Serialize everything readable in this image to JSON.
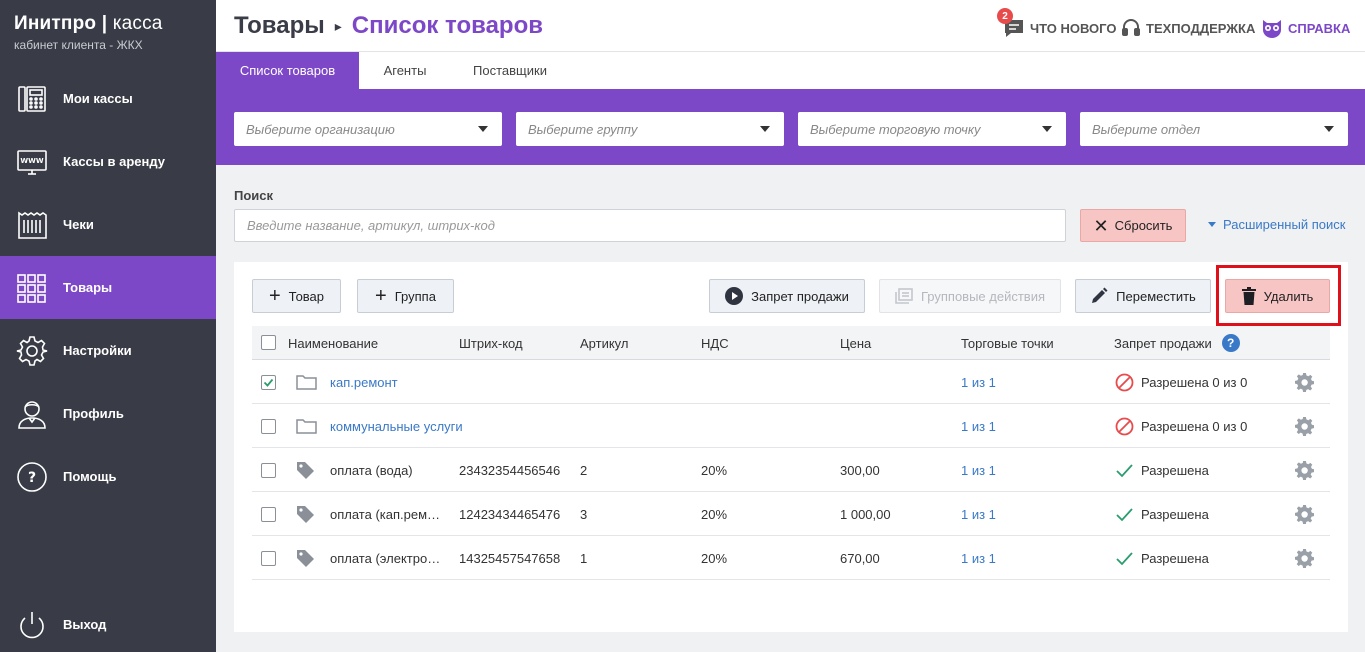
{
  "sidebar": {
    "brand_name": "Инитпро",
    "brand_sep": " | ",
    "brand_product": "касса",
    "brand_sub": "кабинет клиента - ЖКХ",
    "items": [
      {
        "label": "Мои кассы",
        "icon": "cash-register-icon",
        "active": false
      },
      {
        "label": "Кассы в аренду",
        "icon": "www-monitor-icon",
        "active": false
      },
      {
        "label": "Чеки",
        "icon": "receipt-icon",
        "active": false
      },
      {
        "label": "Товары",
        "icon": "grid-icon",
        "active": true
      },
      {
        "label": "Настройки",
        "icon": "gear-icon",
        "active": false
      },
      {
        "label": "Профиль",
        "icon": "user-icon",
        "active": false
      },
      {
        "label": "Помощь",
        "icon": "question-icon",
        "active": false
      }
    ],
    "logout": "Выход"
  },
  "header": {
    "crumb_parent": "Товары",
    "crumb_sep": "▸",
    "crumb_current": "Список товаров",
    "whats_new": "ЧТО НОВОГО",
    "whats_new_badge": "2",
    "support": "ТЕХПОДДЕРЖКА",
    "help": "СПРАВКА"
  },
  "tabs": [
    "Список товаров",
    "Агенты",
    "Поставщики"
  ],
  "filters": {
    "organization": "Выберите организацию",
    "group": "Выберите группу",
    "point": "Выберите торговую точку",
    "department": "Выберите отдел"
  },
  "search": {
    "label": "Поиск",
    "placeholder": "Введите название, артикул, штрих-код",
    "reset": "Сбросить",
    "advanced": "Расширенный поиск"
  },
  "toolbar": {
    "add_product": "Товар",
    "add_group": "Группа",
    "ban_sale": "Запрет продажи",
    "group_actions": "Групповые действия",
    "move": "Переместить",
    "delete": "Удалить"
  },
  "table": {
    "headers": {
      "name": "Наименование",
      "barcode": "Штрих-код",
      "article": "Артикул",
      "vat": "НДС",
      "price": "Цена",
      "points": "Торговые точки",
      "ban": "Запрет продажи",
      "help": "?"
    },
    "rows": [
      {
        "type": "folder",
        "checked": true,
        "name": "кап.ремонт",
        "barcode": "",
        "article": "",
        "vat": "",
        "price": "",
        "points": "1 из 1",
        "status": "Разрешена 0 из 0",
        "status_icon": "ban-icon"
      },
      {
        "type": "folder",
        "checked": false,
        "name": "коммунальные услуги",
        "barcode": "",
        "article": "",
        "vat": "",
        "price": "",
        "points": "1 из 1",
        "status": "Разрешена 0 из 0",
        "status_icon": "ban-icon"
      },
      {
        "type": "item",
        "checked": false,
        "name": "оплата (вода)",
        "barcode": "23432354456546",
        "article": "2",
        "vat": "20%",
        "price": "300,00",
        "points": "1 из 1",
        "status": "Разрешена",
        "status_icon": "check-icon"
      },
      {
        "type": "item",
        "checked": false,
        "name": "оплата (кап.рем…",
        "barcode": "12423434465476",
        "article": "3",
        "vat": "20%",
        "price": "1 000,00",
        "points": "1 из 1",
        "status": "Разрешена",
        "status_icon": "check-icon"
      },
      {
        "type": "item",
        "checked": false,
        "name": "оплата (электро…",
        "barcode": "14325457547658",
        "article": "1",
        "vat": "20%",
        "price": "670,00",
        "points": "1 из 1",
        "status": "Разрешена",
        "status_icon": "check-icon"
      }
    ]
  },
  "colors": {
    "sidebar_bg": "#393c47",
    "accent_purple": "#7d48c7",
    "link_blue": "#3a79c7",
    "danger_bg": "#f7c6c4",
    "highlight_red": "#e0101a",
    "check_green": "#2a9d6e",
    "ban_red": "#e84b4b"
  }
}
